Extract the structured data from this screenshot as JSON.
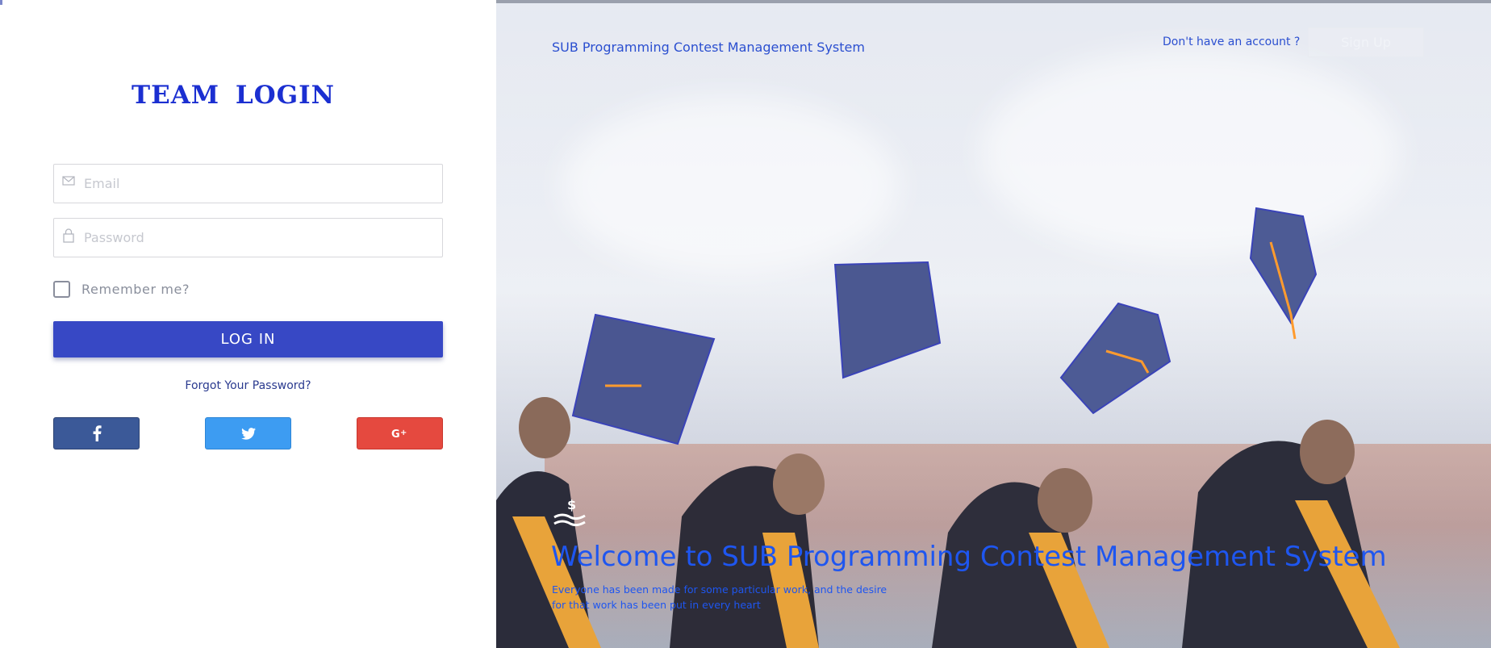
{
  "login": {
    "title": "TEAM  LOGIN",
    "email_placeholder": "Email",
    "password_placeholder": "Password",
    "remember_label": "Remember me?",
    "login_button": "LOG IN",
    "forgot_link": "Forgot Your Password?",
    "social": [
      {
        "name": "facebook",
        "icon": "facebook-icon",
        "color": "#3b5998"
      },
      {
        "name": "twitter",
        "icon": "twitter-icon",
        "color": "#3d9cf2"
      },
      {
        "name": "google-plus",
        "icon": "google-plus-icon",
        "color": "#e5493f"
      }
    ]
  },
  "header": {
    "brand": "SUB Programming Contest Management System",
    "no_account": "Don't have an account ?",
    "signup_button": "Sign Up"
  },
  "hero": {
    "welcome": "Welcome to SUB Programming Contest Management System",
    "subtitle": "Everyone has been made for some particular work, and the desire for that work has been put in every heart"
  },
  "colors": {
    "accent": "#3748c5",
    "title": "#1b2fd1",
    "link": "#2b4fd0"
  }
}
